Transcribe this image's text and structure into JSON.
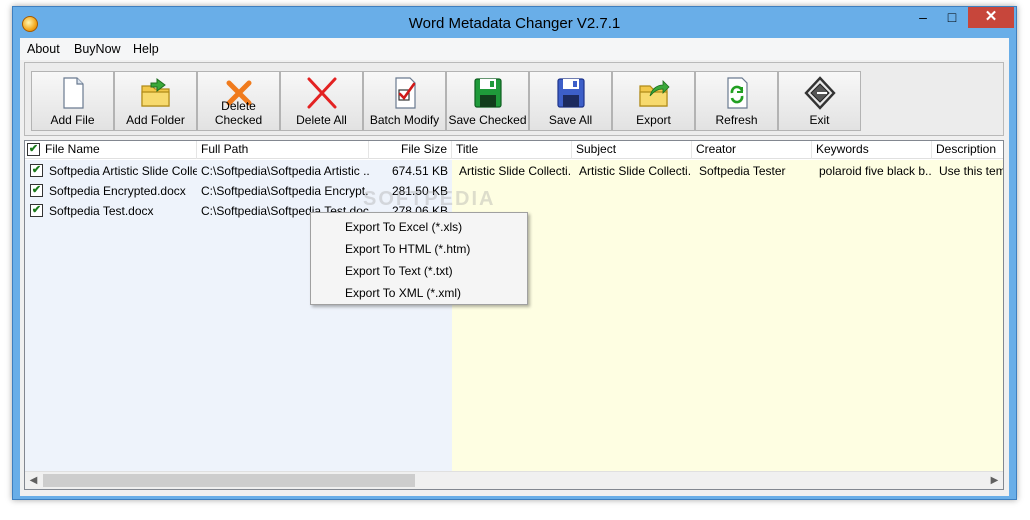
{
  "window": {
    "title": "Word Metadata Changer V2.7.1",
    "controls": {
      "minimize": "–",
      "maximize": "□",
      "close": "✕"
    }
  },
  "menu": [
    "About",
    "BuyNow",
    "Help"
  ],
  "toolbar": [
    {
      "label": "Add File",
      "icon": "document-icon"
    },
    {
      "label": "Add Folder",
      "icon": "folder-icon"
    },
    {
      "label": "Delete Checked",
      "icon": "orange-x-icon"
    },
    {
      "label": "Delete All",
      "icon": "red-x-icon"
    },
    {
      "label": "Batch Modify",
      "icon": "checklist-icon"
    },
    {
      "label": "Save Checked",
      "icon": "green-floppy-icon"
    },
    {
      "label": "Save All",
      "icon": "blue-floppy-icon"
    },
    {
      "label": "Export",
      "icon": "export-folder-icon"
    },
    {
      "label": "Refresh",
      "icon": "refresh-icon"
    },
    {
      "label": "Exit",
      "icon": "exit-icon"
    }
  ],
  "table": {
    "columns": [
      "File Name",
      "Full Path",
      "File Size",
      "Title",
      "Subject",
      "Creator",
      "Keywords",
      "Description"
    ],
    "rows": [
      {
        "checked": true,
        "file_name": "Softpedia Artistic Slide Colle...",
        "full_path": "C:\\Softpedia\\Softpedia Artistic ...",
        "file_size": "674.51 KB",
        "title": "Artistic Slide Collecti...",
        "subject": "Artistic Slide Collecti...",
        "creator": "Softpedia Tester",
        "keywords": "polaroid five black b...",
        "description": "Use this tem"
      },
      {
        "checked": true,
        "file_name": "Softpedia Encrypted.docx",
        "full_path": "C:\\Softpedia\\Softpedia Encrypt...",
        "file_size": "281.50 KB",
        "title": "",
        "subject": "",
        "creator": "",
        "keywords": "",
        "description": ""
      },
      {
        "checked": true,
        "file_name": "Softpedia Test.docx",
        "full_path": "C:\\Softpedia\\Softpedia Test.docx",
        "file_size": "278.06 KB",
        "title": "",
        "subject": "",
        "creator": "",
        "keywords": "",
        "description": ""
      }
    ]
  },
  "context_menu": [
    "Export To Excel (*.xls)",
    "Export To HTML (*.htm)",
    "Export To Text (*.txt)",
    "Export To XML (*.xml)"
  ],
  "watermark": "SOFTPEDIA",
  "colors": {
    "title_bar": "#69aee8",
    "close_button": "#c7463b",
    "metadata_pane": "#fefee2"
  }
}
